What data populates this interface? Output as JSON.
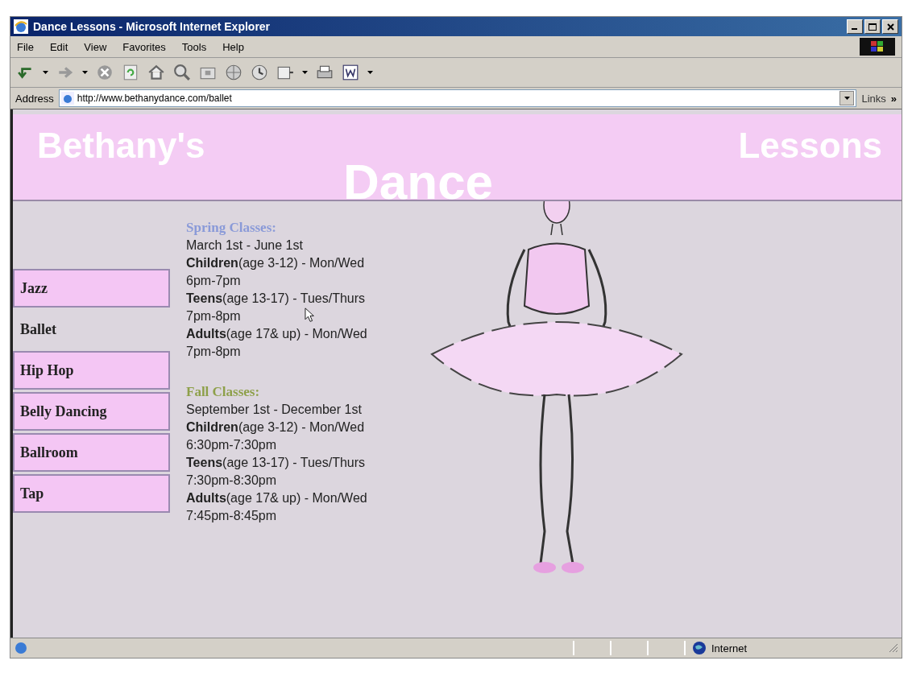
{
  "window": {
    "title": "Dance Lessons - Microsoft Internet Explorer"
  },
  "menu": [
    "File",
    "Edit",
    "View",
    "Favorites",
    "Tools",
    "Help"
  ],
  "address": {
    "label": "Address",
    "url": "http://www.bethanydance.com/ballet",
    "links": "Links",
    "more": "»"
  },
  "page": {
    "header": {
      "left": "Bethany's",
      "center": "Dance",
      "right": "Lessons"
    },
    "nav": [
      {
        "label": "Jazz",
        "selected": false
      },
      {
        "label": "Ballet",
        "selected": true
      },
      {
        "label": "Hip Hop",
        "selected": false
      },
      {
        "label": "Belly Dancing",
        "selected": false
      },
      {
        "label": "Ballroom",
        "selected": false
      },
      {
        "label": "Tap",
        "selected": false
      }
    ],
    "sections": [
      {
        "heading": "Spring Classes:",
        "color": "#8a9ad8",
        "lines": [
          "March 1st - June 1st",
          "**Children**(age 3-12) - Mon/Wed",
          "6pm-7pm",
          "**Teens**(age 13-17) - Tues/Thurs",
          "7pm-8pm",
          "**Adults**(age 17& up) - Mon/Wed",
          "7pm-8pm"
        ]
      },
      {
        "heading": "Fall Classes:",
        "color": "#8ea04a",
        "lines": [
          "September 1st - December 1st",
          "**Children**(age 3-12) - Mon/Wed",
          "6:30pm-7:30pm",
          "**Teens**(age 13-17) - Tues/Thurs",
          "7:30pm-8:30pm",
          "**Adults**(age 17& up) - Mon/Wed",
          "7:45pm-8:45pm"
        ]
      }
    ]
  },
  "status_bar": {
    "zone": "Internet"
  }
}
